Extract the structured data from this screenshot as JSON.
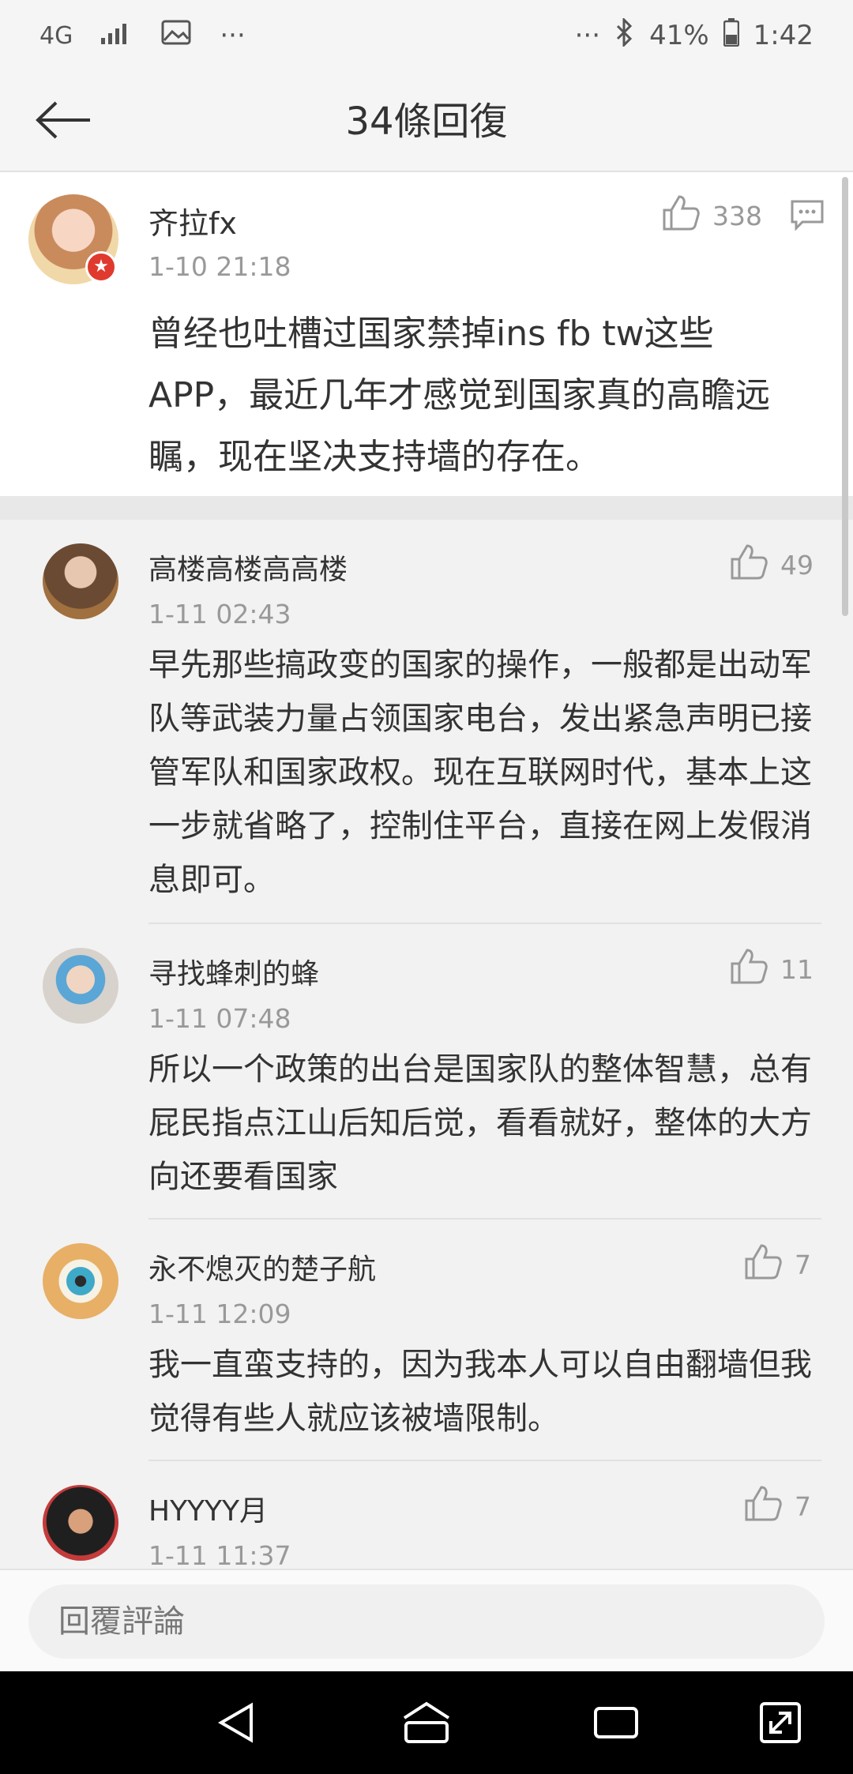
{
  "status": {
    "network": "4G",
    "dots_left": "···",
    "dots_right": "···",
    "battery": "41%",
    "time": "1:42"
  },
  "header": {
    "title": "34條回復"
  },
  "main_comment": {
    "name": "齐拉fx",
    "time": "1-10 21:18",
    "likes": "338",
    "content": "曾经也吐槽过国家禁掉ins fb tw这些APP，最近几年才感觉到国家真的高瞻远瞩，现在坚决支持墙的存在。"
  },
  "replies": [
    {
      "name": "高楼高楼高高楼",
      "time": "1-11 02:43",
      "likes": "49",
      "content": "早先那些搞政变的国家的操作，一般都是出动军队等武装力量占领国家电台，发出紧急声明已接管军队和国家政权。现在互联网时代，基本上这一步就省略了，控制住平台，直接在网上发假消息即可。"
    },
    {
      "name": "寻找蜂刺的蜂",
      "time": "1-11 07:48",
      "likes": "11",
      "content": "所以一个政策的出台是国家队的整体智慧，总有屁民指点江山后知后觉，看看就好，整体的大方向还要看国家"
    },
    {
      "name": "永不熄灭的楚子航",
      "time": "1-11 12:09",
      "likes": "7",
      "content": "我一直蛮支持的，因为我本人可以自由翻墙但我觉得有些人就应该被墙限制。"
    },
    {
      "name": "HYYYY月",
      "time": "1-11 11:37",
      "likes": "7",
      "content": ""
    }
  ],
  "input": {
    "placeholder": "回覆評論"
  },
  "icons": {
    "back": "arrow-left-icon",
    "like": "thumbs-up-icon",
    "comment": "comment-icon",
    "bluetooth": "bluetooth-icon",
    "battery": "battery-icon",
    "signal": "signal-icon",
    "image": "image-icon"
  }
}
